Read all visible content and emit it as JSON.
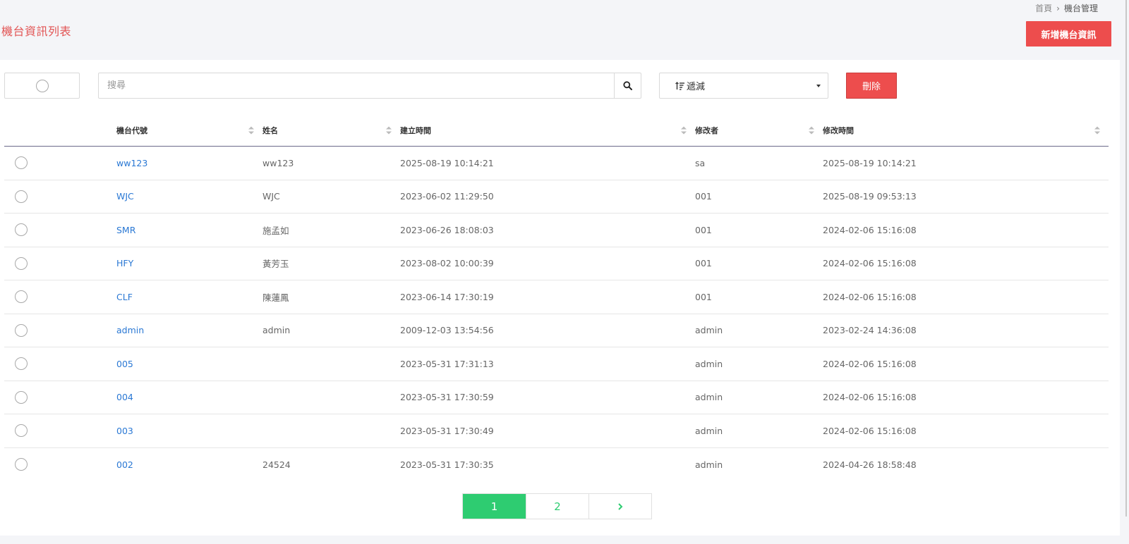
{
  "breadcrumb": {
    "home": "首頁",
    "current": "機台管理"
  },
  "page": {
    "title": "機台資訊列表",
    "add_button": "新增機台資訊"
  },
  "toolbar": {
    "search_placeholder": "搜尋",
    "sort_label": "遞減",
    "delete_button": "刪除"
  },
  "table": {
    "headers": [
      "機台代號",
      "姓名",
      "建立時間",
      "修改者",
      "修改時間"
    ],
    "rows": [
      {
        "code": "ww123",
        "name": "ww123",
        "created": "2025-08-19 10:14:21",
        "modifier": "sa",
        "modified": "2025-08-19 10:14:21"
      },
      {
        "code": "WJC",
        "name": "WJC",
        "created": "2023-06-02 11:29:50",
        "modifier": "001",
        "modified": "2025-08-19 09:53:13"
      },
      {
        "code": "SMR",
        "name": "施孟如",
        "created": "2023-06-26 18:08:03",
        "modifier": "001",
        "modified": "2024-02-06 15:16:08"
      },
      {
        "code": "HFY",
        "name": "黃芳玉",
        "created": "2023-08-02 10:00:39",
        "modifier": "001",
        "modified": "2024-02-06 15:16:08"
      },
      {
        "code": "CLF",
        "name": "陳蓮鳳",
        "created": "2023-06-14 17:30:19",
        "modifier": "001",
        "modified": "2024-02-06 15:16:08"
      },
      {
        "code": "admin",
        "name": "admin",
        "created": "2009-12-03 13:54:56",
        "modifier": "admin",
        "modified": "2023-02-24 14:36:08"
      },
      {
        "code": "005",
        "name": "",
        "created": "2023-05-31 17:31:13",
        "modifier": "admin",
        "modified": "2024-02-06 15:16:08"
      },
      {
        "code": "004",
        "name": "",
        "created": "2023-05-31 17:30:59",
        "modifier": "admin",
        "modified": "2024-02-06 15:16:08"
      },
      {
        "code": "003",
        "name": "",
        "created": "2023-05-31 17:30:49",
        "modifier": "admin",
        "modified": "2024-02-06 15:16:08"
      },
      {
        "code": "002",
        "name": "24524",
        "created": "2023-05-31 17:30:35",
        "modifier": "admin",
        "modified": "2024-04-26 18:58:48"
      }
    ]
  },
  "pagination": {
    "pages": [
      "1",
      "2"
    ],
    "current": "1"
  },
  "colors": {
    "accent_red": "#ed4d4d",
    "title_red": "#e25454",
    "link_blue": "#2a78d4",
    "page_green": "#2ecc71"
  }
}
